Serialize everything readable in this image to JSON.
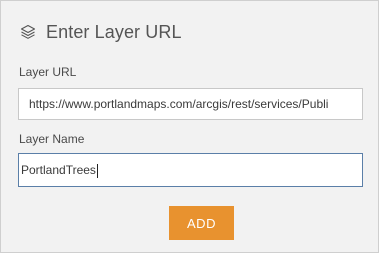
{
  "dialog": {
    "title": "Enter Layer URL",
    "icon": "layers-icon"
  },
  "layer_url": {
    "label": "Layer URL",
    "value": "https://www.portlandmaps.com/arcgis/rest/services/Publi"
  },
  "layer_name": {
    "label": "Layer Name",
    "value": "PortlandTrees"
  },
  "actions": {
    "add_label": "ADD"
  },
  "colors": {
    "panel_background": "#f2f2f2",
    "accent_button": "#e8922f",
    "focused_border": "#5b7fa8"
  }
}
